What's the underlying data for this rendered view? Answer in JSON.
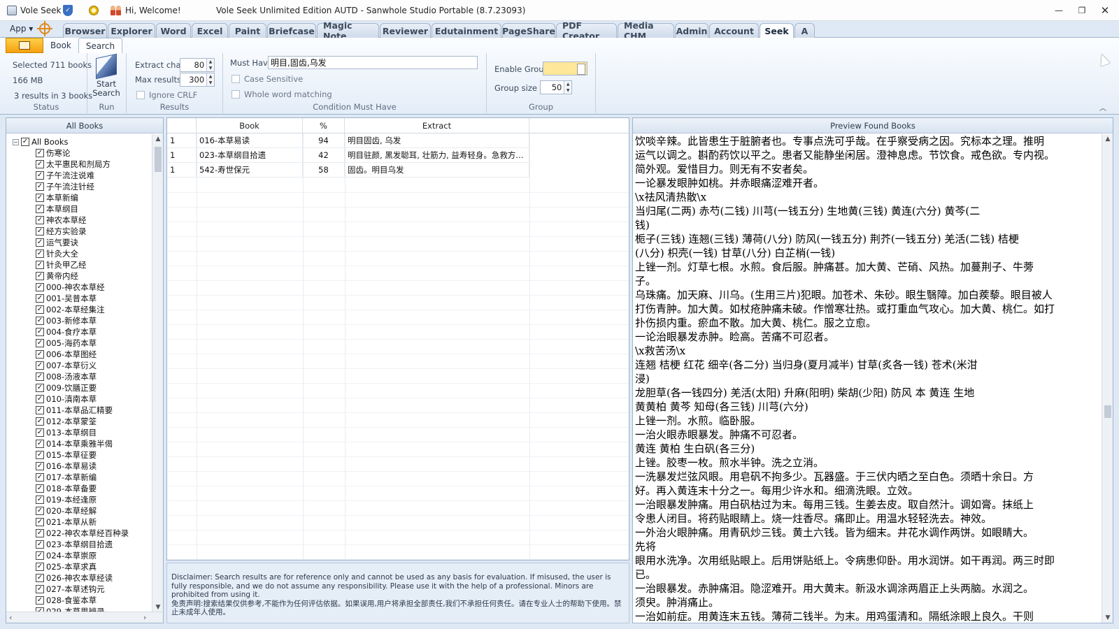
{
  "titlebar": {
    "app_name": "Vole Seek",
    "welcome": "Hi, Welcome!",
    "window_title": "Vole Seek Unlimited Edition AUTD - Sanwhole Studio Portable (8.7.23093)"
  },
  "app_menu": "App ▾",
  "top_tabs": [
    "Browser",
    "Explorer",
    "Word",
    "Excel",
    "Paint",
    "Briefcase",
    "Magic Note",
    "Reviewer",
    "Edutainment",
    "PageShare",
    "PDF Creator",
    "Media CHM",
    "Admin",
    "Account",
    "Seek",
    "A"
  ],
  "active_top_tab": "Seek",
  "ribbon": {
    "tabs": [
      "Book",
      "Search"
    ],
    "active_tab": "Search",
    "status": {
      "selected": "Selected 711 books",
      "size": "166 MB",
      "results": "3 results in 3 books",
      "label": "Status"
    },
    "run": {
      "button_line1": "Start",
      "button_line2": "Search",
      "label": "Run"
    },
    "results_group": {
      "extract_chars_label": "Extract chars",
      "extract_chars_value": "80",
      "max_results_label": "Max results",
      "max_results_value": "300",
      "ignore_crlf_label": "Ignore CRLF",
      "label": "Results"
    },
    "condition": {
      "must_have_label": "Must Have",
      "must_have_value": "明目,固齿,乌发",
      "case_sensitive_label": "Case Sensitive",
      "whole_word_label": "Whole word matching",
      "label": "Condition Must Have"
    },
    "group": {
      "enable_group_label": "Enable Group",
      "enable_group_color": "#ffe79a",
      "group_size_label": "Group size",
      "group_size_value": "50",
      "label": "Group"
    }
  },
  "tree": {
    "header": "All Books",
    "root": "All Books",
    "items": [
      "伤寒论",
      "太平惠民和剂局方",
      "子午流注说难",
      "子午流注针经",
      "本草新编",
      "本草纲目",
      "神农本草经",
      "经方实验录",
      "运气要诀",
      "针灸大全",
      "针灸甲乙经",
      "黄帝内经",
      "000-神农本草经",
      "001-吴普本草",
      "002-本草经集注",
      "003-新修本草",
      "004-食疗本草",
      "005-海药本草",
      "006-本草图经",
      "007-本草衍义",
      "008-汤液本草",
      "009-饮膳正要",
      "010-滇南本草",
      "011-本草品汇精要",
      "012-本草蒙筌",
      "013-本草纲目",
      "014-本草乘雅半偈",
      "015-本草征要",
      "016-本草易读",
      "017-本草新编",
      "018-本草备要",
      "019-本经逢原",
      "020-本草经解",
      "021-本草从新",
      "022-神农本草经百种录",
      "023-本草纲目拾遗",
      "024-本草崇原",
      "025-本草求真",
      "026-神农本草经读",
      "027-本草述钩元",
      "028-食鉴本草",
      "029-本草思辨录"
    ]
  },
  "results": {
    "columns": [
      "",
      "Book",
      "%",
      "Extract"
    ],
    "rows": [
      {
        "n": "1",
        "book": "016-本草易读",
        "pct": "94",
        "extract": "明目固齿, 乌发"
      },
      {
        "n": "1",
        "book": "023-本草纲目拾遗",
        "pct": "42",
        "extract": "明目驻颜, 黑发聪耳, 壮筋力, 益寿轻身。急救方..."
      },
      {
        "n": "1",
        "book": "542-寿世保元",
        "pct": "58",
        "extract": "固齿。明目乌发"
      }
    ]
  },
  "disclaimer": {
    "en": "Disclaimer: Search results are for reference only and cannot be used as any basis for evaluation. If misused, the user is fully responsible, and we do not assume any responsibility. Please use it with the help of a professional. Minors are prohibited from using it.",
    "zh": "免责声明:搜索结果仅供参考,不能作为任何评估依据。如果误用,用户将承担全部责任,我们不承担任何责任。请在专业人士的帮助下使用。禁止未成年人使用。"
  },
  "preview": {
    "header": "Preview Found Books",
    "lines": [
      "饮啖辛辣。此皆患生于脏腑者也。专事点洗可乎哉。在乎察受病之因。究标本之理。推明",
      "运气以调之。斟酌药饮以平之。患者又能静坐闲居。澄神息虑。节饮食。戒色欲。专内视。",
      "简外观。爱惜目力。则无有不安者矣。",
      "一论暴发眼肿如桃。并赤眼痛涩难开者。",
      "\\x祛风清热散\\x",
      "当归尾(二两) 赤芍(二钱) 川芎(一钱五分) 生地黄(三钱) 黄连(六分) 黄芩(二",
      "钱)",
      "栀子(三钱) 连翘(三钱) 薄荷(八分) 防风(一钱五分) 荆芥(一钱五分) 羌活(二钱) 桔梗",
      "(八分) 枳壳(一钱) 甘草(八分) 白芷梢(一钱)",
      "上锉一剂。灯草七根。水煎。食后服。肿痛甚。加大黄、芒硝、风热。加蔓荆子、牛蒡",
      "子。",
      "乌珠痛。加天麻、川乌。(生用三片)犯眼。加苍术、朱砂。眼生翳障。加白蒺藜。眼目被人",
      "打伤青肿。加大黄。如杖疮肿痛未破。作憎寒壮热。或打重血气攻心。加大黄、桃仁。如打",
      "扑伤损内重。瘀血不散。加大黄、桃仁。服之立愈。",
      "一论治眼暴发赤肿。睑高。苦痛不可忍者。",
      "\\x救苦汤\\x",
      "连翘 桔梗 红花 细辛(各二分) 当归身(夏月减半) 甘草(炙各一钱) 苍术(米泔",
      "浸)",
      "龙胆草(各一钱四分) 羌活(太阳) 升麻(阳明) 柴胡(少阳) 防风 本 黄连 生地",
      "黄黄柏 黄芩 知母(各三钱) 川芎(六分)",
      "上锉一剂。水煎。临卧服。",
      "一治火眼赤眼暴发。肿痛不可忍者。",
      "黄连 黄柏 生白矾(各三分)",
      "上锉。胶枣一枚。煎水半钟。洗之立消。",
      "一洗暴发烂弦风眼。用皂矾不拘多少。瓦器盛。于三伏内晒之至白色。须晒十余日。方",
      "好。再入黄连末十分之一。每用少许水和。细滴洗眼。立效。",
      "一治眼暴发肿痛。用白矾枯过为末。每用三钱。生姜去皮。取自然汁。调如膏。抹纸上",
      "令患人闭目。将药贴眼睛上。烧一炷香尽。痛即止。用温水轻轻洗去。神效。",
      "一外治火眼肿痛。用青矾炒三钱。黄土六钱。皆为细末。井花水调作两饼。如眼睛大。",
      "先将",
      "眼用水洗净。次用纸贴眼上。后用饼贴纸上。令病患仰卧。用水润饼。如干再润。两三时即",
      "已。",
      "一治眼暴发。赤肿痛泪。隐涩难开。用大黄末。新汲水调涂两眉正上头两脑。水润之。",
      "须臾。肿消痛止。",
      "一治如前症。用黄连末五钱。薄荷二钱半。为末。用鸡蛋清和。隔纸涂眼上良久。干则"
    ]
  }
}
